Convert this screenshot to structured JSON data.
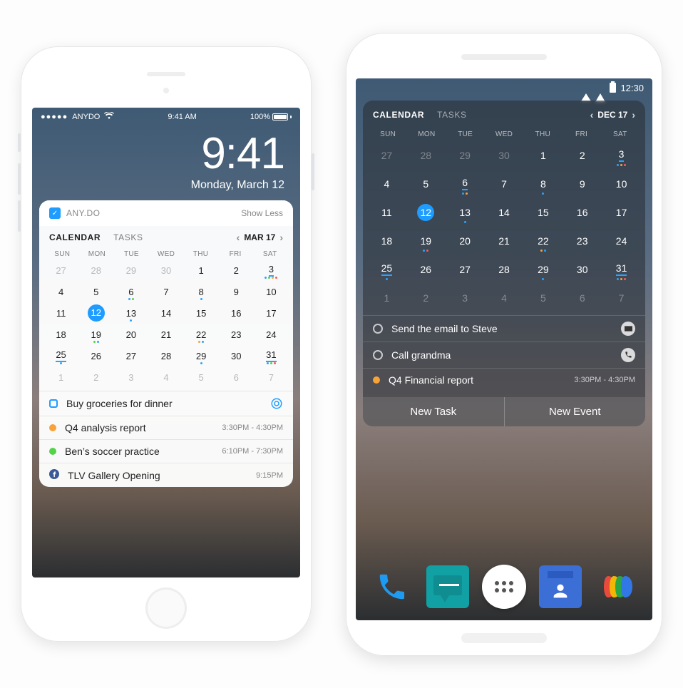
{
  "ios": {
    "status": {
      "carrier": "ANYDO",
      "time": "9:41 AM",
      "battery": "100%"
    },
    "lock": {
      "time": "9:41",
      "date": "Monday, March 12"
    },
    "widget": {
      "app_name": "ANY.DO",
      "toggle": "Show Less",
      "tabs": {
        "calendar": "CALENDAR",
        "tasks": "TASKS"
      },
      "nav_label": "MAR 17",
      "dow": [
        "SUN",
        "MON",
        "TUE",
        "WED",
        "THU",
        "FRI",
        "SAT"
      ],
      "weeks": [
        [
          {
            "n": "27",
            "dim": true
          },
          {
            "n": "28",
            "dim": true
          },
          {
            "n": "29",
            "dim": true
          },
          {
            "n": "30",
            "dim": true
          },
          {
            "n": "1"
          },
          {
            "n": "2"
          },
          {
            "n": "3",
            "ul": true,
            "dots": [
              "blue",
              "green",
              "orange",
              "red"
            ]
          }
        ],
        [
          {
            "n": "4"
          },
          {
            "n": "5"
          },
          {
            "n": "6",
            "dots": [
              "blue",
              "green"
            ]
          },
          {
            "n": "7"
          },
          {
            "n": "8",
            "dots": [
              "blue"
            ]
          },
          {
            "n": "9"
          },
          {
            "n": "10"
          }
        ],
        [
          {
            "n": "11"
          },
          {
            "n": "12",
            "sel": true
          },
          {
            "n": "13",
            "dots": [
              "blue"
            ]
          },
          {
            "n": "14"
          },
          {
            "n": "15"
          },
          {
            "n": "16"
          },
          {
            "n": "17"
          }
        ],
        [
          {
            "n": "18"
          },
          {
            "n": "19",
            "dots": [
              "green",
              "blue"
            ]
          },
          {
            "n": "20"
          },
          {
            "n": "21"
          },
          {
            "n": "22",
            "dots": [
              "orange",
              "blue"
            ]
          },
          {
            "n": "23"
          },
          {
            "n": "24"
          }
        ],
        [
          {
            "n": "25",
            "ul": true,
            "dots": [
              "blue"
            ]
          },
          {
            "n": "26"
          },
          {
            "n": "27"
          },
          {
            "n": "28"
          },
          {
            "n": "29",
            "dots": [
              "blue"
            ]
          },
          {
            "n": "30"
          },
          {
            "n": "31",
            "ul": true,
            "dots": [
              "blue",
              "green",
              "red"
            ]
          }
        ],
        [
          {
            "n": "1",
            "dim": true
          },
          {
            "n": "2",
            "dim": true
          },
          {
            "n": "3",
            "dim": true
          },
          {
            "n": "4",
            "dim": true
          },
          {
            "n": "5",
            "dim": true
          },
          {
            "n": "6",
            "dim": true
          },
          {
            "n": "7",
            "dim": true
          }
        ]
      ],
      "items": [
        {
          "kind": "task",
          "title": "Buy groceries for dinner",
          "trail": "target"
        },
        {
          "kind": "event",
          "color": "#f8a23a",
          "title": "Q4 analysis report",
          "time": "3:30PM - 4:30PM"
        },
        {
          "kind": "event",
          "color": "#53d24a",
          "title": "Ben’s soccer practice",
          "time": "6:10PM - 7:30PM"
        },
        {
          "kind": "fb",
          "title": "TLV Gallery Opening",
          "time": "9:15PM"
        }
      ]
    }
  },
  "android": {
    "status_time": "12:30",
    "widget": {
      "tabs": {
        "calendar": "CALENDAR",
        "tasks": "TASKS"
      },
      "nav_label": "DEC 17",
      "dow": [
        "SUN",
        "MON",
        "TUE",
        "WED",
        "THU",
        "FRI",
        "SAT"
      ],
      "weeks": [
        [
          {
            "n": "27",
            "dim": true
          },
          {
            "n": "28",
            "dim": true
          },
          {
            "n": "29",
            "dim": true
          },
          {
            "n": "30",
            "dim": true
          },
          {
            "n": "1"
          },
          {
            "n": "2"
          },
          {
            "n": "3",
            "ul": true,
            "dots": [
              "blue",
              "orange",
              "red"
            ]
          }
        ],
        [
          {
            "n": "4"
          },
          {
            "n": "5"
          },
          {
            "n": "6",
            "ul": true,
            "dots": [
              "blue",
              "orange"
            ]
          },
          {
            "n": "7"
          },
          {
            "n": "8",
            "dots": [
              "blue"
            ]
          },
          {
            "n": "9"
          },
          {
            "n": "10"
          }
        ],
        [
          {
            "n": "11"
          },
          {
            "n": "12",
            "sel": true
          },
          {
            "n": "13",
            "dots": [
              "blue"
            ]
          },
          {
            "n": "14"
          },
          {
            "n": "15"
          },
          {
            "n": "16"
          },
          {
            "n": "17"
          }
        ],
        [
          {
            "n": "18"
          },
          {
            "n": "19",
            "dots": [
              "blue",
              "red"
            ]
          },
          {
            "n": "20"
          },
          {
            "n": "21"
          },
          {
            "n": "22",
            "dots": [
              "orange",
              "blue"
            ]
          },
          {
            "n": "23"
          },
          {
            "n": "24"
          }
        ],
        [
          {
            "n": "25",
            "ul": true,
            "dots": [
              "blue"
            ]
          },
          {
            "n": "26"
          },
          {
            "n": "27"
          },
          {
            "n": "28"
          },
          {
            "n": "29",
            "dots": [
              "blue"
            ]
          },
          {
            "n": "30"
          },
          {
            "n": "31",
            "ul": true,
            "dots": [
              "blue",
              "orange",
              "red"
            ]
          }
        ],
        [
          {
            "n": "1",
            "dim": true
          },
          {
            "n": "2",
            "dim": true
          },
          {
            "n": "3",
            "dim": true
          },
          {
            "n": "4",
            "dim": true
          },
          {
            "n": "5",
            "dim": true
          },
          {
            "n": "6",
            "dim": true
          },
          {
            "n": "7",
            "dim": true
          }
        ]
      ],
      "items": [
        {
          "kind": "task",
          "title": "Send the email to Steve",
          "trail": "mail"
        },
        {
          "kind": "task",
          "title": "Call grandma",
          "trail": "phone"
        },
        {
          "kind": "event",
          "color": "#f8a23a",
          "title": "Q4 Financial report",
          "time": "3:30PM - 4:30PM"
        }
      ],
      "new_task": "New Task",
      "new_event": "New Event"
    }
  }
}
